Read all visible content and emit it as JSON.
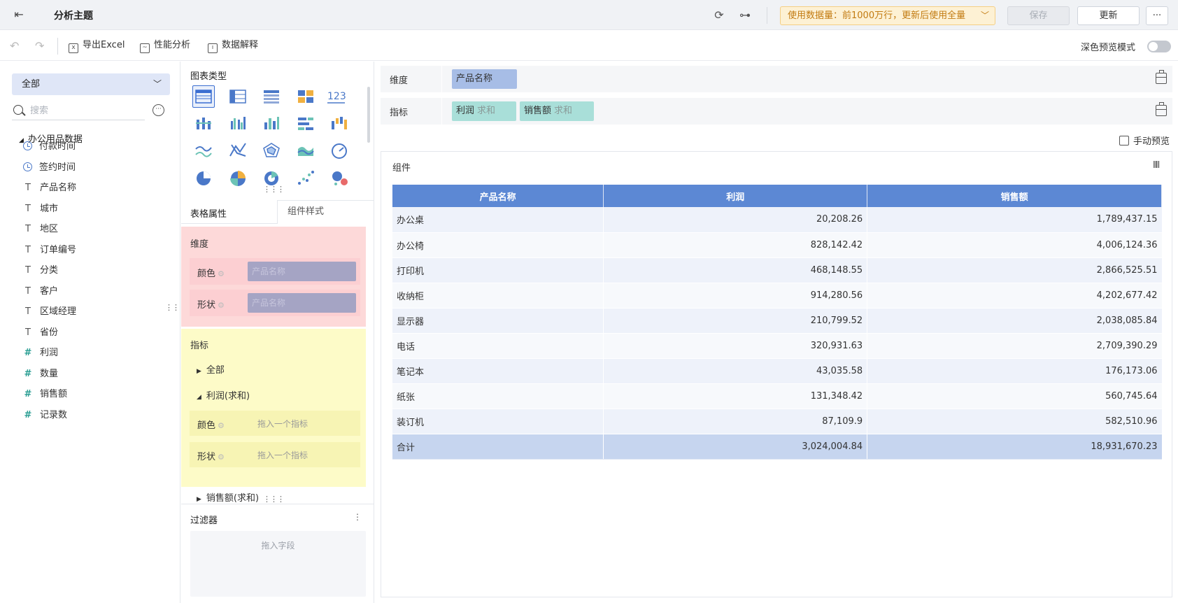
{
  "header": {
    "back_icon": "exit-icon",
    "title": "分析主题",
    "usage_banner": "使用数据量：前1000万行，更新后使用全量",
    "save_label": "保存",
    "update_label": "更新",
    "more_label": "···"
  },
  "toolbar": {
    "export_excel": "导出Excel",
    "perf_analysis": "性能分析",
    "data_explain": "数据解释",
    "dark_mode_label": "深色预览模式"
  },
  "left": {
    "dataset_select": "全部",
    "search_placeholder": "搜索",
    "tree_root": "办公用品数据",
    "fields": [
      {
        "label": "付款时间",
        "type": "time"
      },
      {
        "label": "签约时间",
        "type": "time"
      },
      {
        "label": "产品名称",
        "type": "text"
      },
      {
        "label": "城市",
        "type": "text"
      },
      {
        "label": "地区",
        "type": "text"
      },
      {
        "label": "订单编号",
        "type": "text"
      },
      {
        "label": "分类",
        "type": "text"
      },
      {
        "label": "客户",
        "type": "text"
      },
      {
        "label": "区域经理",
        "type": "text"
      },
      {
        "label": "省份",
        "type": "text"
      },
      {
        "label": "利润",
        "type": "number"
      },
      {
        "label": "数量",
        "type": "number"
      },
      {
        "label": "销售额",
        "type": "number"
      },
      {
        "label": "记录数",
        "type": "number"
      }
    ]
  },
  "middle": {
    "chart_type_title": "图表类型",
    "number_chart_label": "123",
    "tab_table_props": "表格属性",
    "tab_component_style": "组件样式",
    "dimension_title": "维度",
    "color_label": "颜色",
    "shape_label": "形状",
    "dim_color_value": "产品名称",
    "dim_shape_value": "产品名称",
    "measure_title": "指标",
    "measure_all": "全部",
    "measure_profit": "利润(求和)",
    "measure_color_placeholder": "拖入一个指标",
    "measure_shape_placeholder": "拖入一个指标",
    "measure_sales": "销售额(求和)",
    "filter_title": "过滤器",
    "filter_placeholder": "拖入字段"
  },
  "right": {
    "dimension_label": "维度",
    "dimension_pill": "产品名称",
    "measure_label": "指标",
    "measure_pills": [
      {
        "name": "利润",
        "agg": "求和"
      },
      {
        "name": "销售额",
        "agg": "求和"
      }
    ],
    "manual_preview": "手动预览",
    "component_title": "组件"
  },
  "table": {
    "columns": [
      "产品名称",
      "利润",
      "销售额"
    ],
    "rows": [
      [
        "办公桌",
        "20,208.26",
        "1,789,437.15"
      ],
      [
        "办公椅",
        "828,142.42",
        "4,006,124.36"
      ],
      [
        "打印机",
        "468,148.55",
        "2,866,525.51"
      ],
      [
        "收纳柜",
        "914,280.56",
        "4,202,677.42"
      ],
      [
        "显示器",
        "210,799.52",
        "2,038,085.84"
      ],
      [
        "电话",
        "320,931.63",
        "2,709,390.29"
      ],
      [
        "笔记本",
        "43,035.58",
        "176,173.06"
      ],
      [
        "纸张",
        "131,348.42",
        "560,745.64"
      ],
      [
        "装订机",
        "87,109.9",
        "582,510.96"
      ]
    ],
    "total": [
      "合计",
      "3,024,004.84",
      "18,931,670.23"
    ]
  },
  "colors": {
    "accent": "#3b6ed1",
    "table_header": "#5c88d4",
    "dimension_zone": "#fdd9d9",
    "measure_zone": "#fdfbc8",
    "banner_text": "#c27b11"
  }
}
